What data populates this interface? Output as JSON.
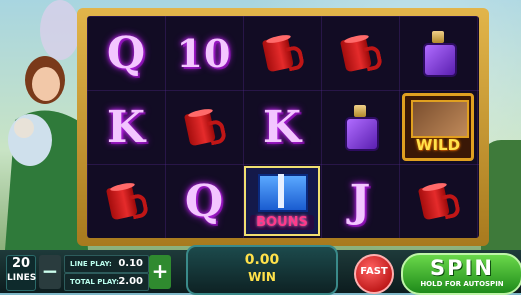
{
  "reels": {
    "symbols": [
      [
        "Q",
        "K",
        "mug-icon"
      ],
      [
        "10",
        "mug-icon",
        "Q"
      ],
      [
        "mug-icon",
        "K",
        "bonus-symbol"
      ],
      [
        "mug-icon",
        "perfume-icon",
        "J"
      ],
      [
        "perfume-icon",
        "wild-symbol",
        "mug-icon"
      ]
    ],
    "wild_label": "WILD",
    "bonus_label": "BOUNS"
  },
  "controls": {
    "lines_value": "20",
    "lines_label": "LINES",
    "minus_label": "−",
    "plus_label": "+",
    "line_play_label": "LINE PLAY:",
    "line_play_value": "0.10",
    "total_play_label": "TOTAL PLAY:",
    "total_play_value": "2.00",
    "win_amount": "0.00",
    "win_label": "WIN",
    "fast_label": "FAST",
    "spin_label": "SPIN",
    "spin_hint": "HOLD FOR AUTOSPIN"
  }
}
